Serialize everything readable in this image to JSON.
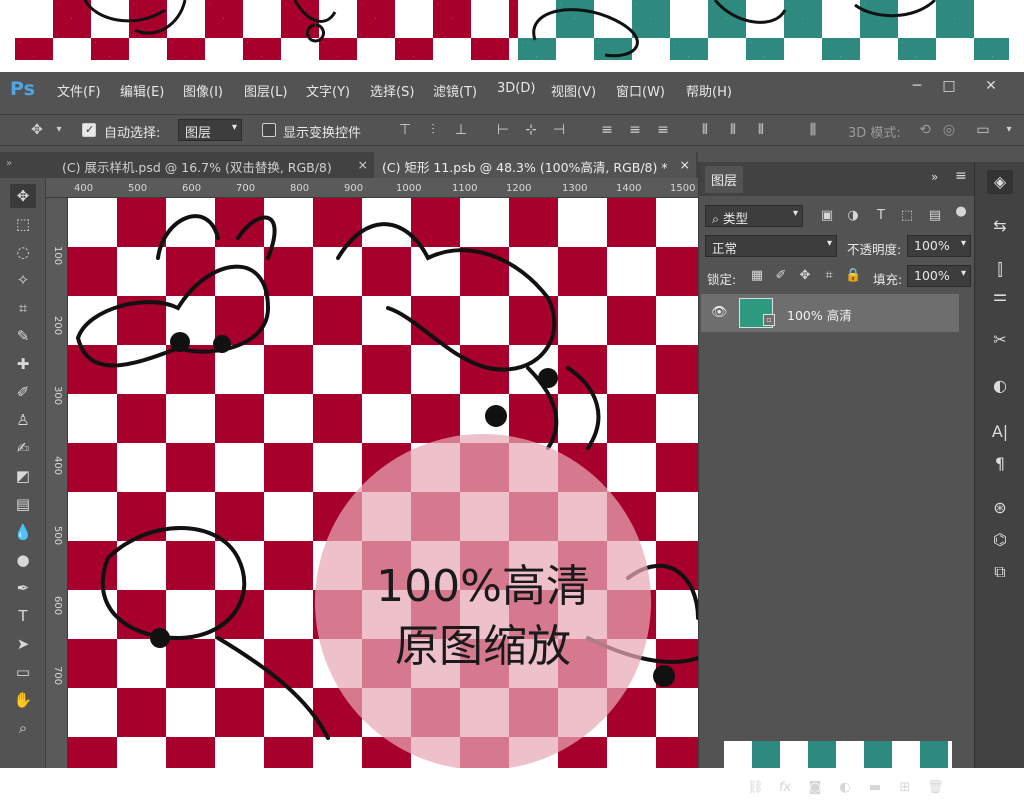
{
  "colors": {
    "pattern_red": "#a8002c",
    "pattern_teal": "#2e8a7e",
    "pattern_light": "#ffffff",
    "ui_bg": "#535353",
    "ui_dark": "#424242",
    "badge": "#e8a8b6",
    "ps_logo": "#4ea6e6",
    "layer_thumb": "#2e9a80"
  },
  "app": {
    "logo": "Ps",
    "menu": [
      "文件(F)",
      "编辑(E)",
      "图像(I)",
      "图层(L)",
      "文字(Y)",
      "选择(S)",
      "滤镜(T)",
      "3D(D)",
      "视图(V)",
      "窗口(W)",
      "帮助(H)"
    ],
    "window_controls": {
      "minimize": "─",
      "maximize": "□",
      "close": "✕"
    }
  },
  "options_bar": {
    "auto_select_label": "自动选择:",
    "auto_select_checked": true,
    "auto_select_target": "图层",
    "show_transform_label": "显示变换控件",
    "show_transform_checked": false,
    "mode_3d_label": "3D 模式:"
  },
  "tabs": [
    {
      "label": "(C) 展示样机.psd @ 16.7% (双击替换, RGB/8)",
      "close": "×"
    },
    {
      "label": "(C) 矩形 11.psb @ 48.3% (100%高清, RGB/8) *",
      "close": "×"
    }
  ],
  "ruler": {
    "h_ticks": [
      "400",
      "500",
      "600",
      "700",
      "800",
      "900",
      "1000",
      "1100",
      "1200",
      "1300",
      "1400",
      "1500"
    ],
    "v_ticks": [
      "100",
      "200",
      "300",
      "400",
      "500",
      "600",
      "700"
    ]
  },
  "canvas": {
    "badge_line1": "100%高清",
    "badge_line2": "原图缩放"
  },
  "tools": [
    "move-tool",
    "marquee-tool",
    "lasso-tool",
    "magic-wand-tool",
    "crop-tool",
    "eyedropper-tool",
    "healing-brush-tool",
    "brush-tool",
    "clone-stamp-tool",
    "history-brush-tool",
    "eraser-tool",
    "gradient-tool",
    "blur-tool",
    "dodge-tool",
    "pen-tool",
    "type-tool",
    "path-selection-tool",
    "rectangle-tool",
    "hand-tool",
    "zoom-tool"
  ],
  "layers_panel": {
    "title": "图层",
    "filter_label": "类型",
    "blend_mode": "正常",
    "opacity_label": "不透明度:",
    "opacity_value": "100%",
    "lock_label": "锁定:",
    "fill_label": "填充:",
    "fill_value": "100%",
    "layers": [
      {
        "name": "100% 高清",
        "visible": true
      }
    ]
  },
  "dock_icons": [
    "layers-icon",
    "history-icon",
    "adjustments-icon",
    "properties-icon",
    "tools-icon",
    "swatches-icon",
    "character-icon",
    "paragraph-icon",
    "channels-icon",
    "paths-icon",
    "3d-icon"
  ]
}
